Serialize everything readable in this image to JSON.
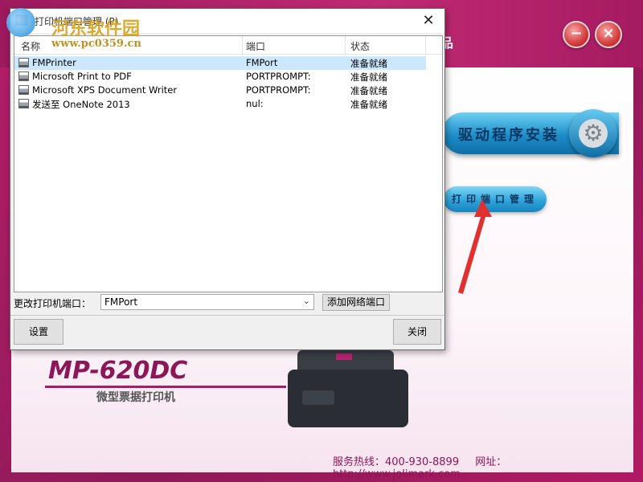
{
  "colors": {
    "brand": "#a21e66",
    "accent_blue": "#1d8ec9",
    "selection": "#cce8ff"
  },
  "watermark": {
    "site_name": "河东软件园",
    "url": "www.pc0359.cn",
    "icon": "watermark-logo-icon"
  },
  "app": {
    "title_suffix": "品",
    "minimize_label": "−",
    "close_label": "×",
    "driver_install_label": "驱动程序安装",
    "driver_icon": "gear-icon",
    "port_manage_label": "打印端口管理",
    "model_name": "MP-620DC",
    "model_subtitle": "微型票据打印机",
    "footer": {
      "hotline": "服务热线：400-930-8899",
      "website": "网址：http://www.jolimark.com"
    }
  },
  "dialog": {
    "title": "打印机端口管理 (P)",
    "close_label": "✕",
    "columns": {
      "name": "名称",
      "port": "端口",
      "status": "状态"
    },
    "printers": [
      {
        "name": "FMPrinter",
        "port": "FMPort",
        "status": "准备就绪",
        "selected": true
      },
      {
        "name": "Microsoft Print to PDF",
        "port": "PORTPROMPT:",
        "status": "准备就绪",
        "selected": false
      },
      {
        "name": "Microsoft XPS Document Writer",
        "port": "PORTPROMPT:",
        "status": "准备就绪",
        "selected": false
      },
      {
        "name": "发送至 OneNote 2013",
        "port": "nul:",
        "status": "准备就绪",
        "selected": false
      }
    ],
    "change_port_label": "更改打印机端口：",
    "port_select": {
      "value": "FMPort"
    },
    "add_network_port_label": "添加网络端口",
    "setup_label": "设置",
    "close_button_label": "关闭"
  }
}
